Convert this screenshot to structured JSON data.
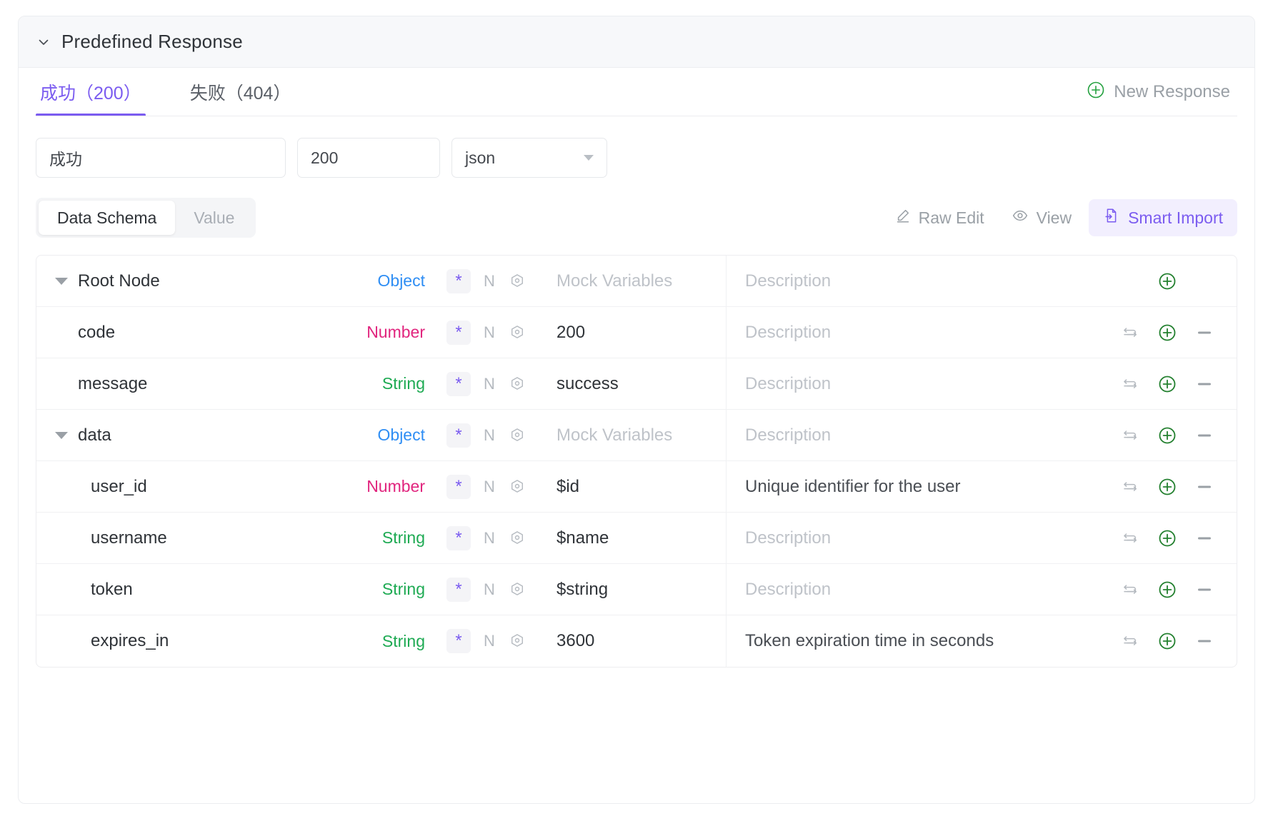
{
  "panel": {
    "title": "Predefined Response",
    "collapse_icon": "chevron-down-icon"
  },
  "tabs": [
    {
      "label": "成功（200）",
      "active": true
    },
    {
      "label": "失败（404）",
      "active": false
    }
  ],
  "new_response": {
    "label": "New Response",
    "icon": "plus-circle-icon",
    "icon_color": "#23a03e"
  },
  "fields": {
    "name_value": "成功",
    "code_value": "200",
    "type_value": "json",
    "type_caret": "chevron-down-icon"
  },
  "view_toggle": [
    {
      "label": "Data Schema",
      "active": true
    },
    {
      "label": "Value",
      "active": false
    }
  ],
  "tool_actions": [
    {
      "label": "Raw Edit",
      "icon": "pencil-icon",
      "accent": false
    },
    {
      "label": "View",
      "icon": "eye-icon",
      "accent": false
    },
    {
      "label": "Smart Import",
      "icon": "import-file-icon",
      "accent": true
    }
  ],
  "colors": {
    "accent_purple": "#7b5cf0",
    "accent_purple_bg": "#f2effe",
    "type_object": "#2f8ef4",
    "type_number": "#e1257e",
    "type_string": "#1eaa53",
    "green_add": "#23a03e",
    "header_bg": "#f7f8fa"
  },
  "schema_rows": [
    {
      "name": "Root Node",
      "indent": 0,
      "expandable": true,
      "type": "Object",
      "type_class": "t-object",
      "required_mark": "*",
      "null_mark": "N",
      "settings_icon": "hexagon-settings-icon",
      "mock": "Mock Variables",
      "mock_placeholder": true,
      "description": "Description",
      "description_placeholder": true,
      "ops": [
        "add"
      ]
    },
    {
      "name": "code",
      "indent": 1,
      "expandable": false,
      "type": "Number",
      "type_class": "t-number",
      "required_mark": "*",
      "null_mark": "N",
      "settings_icon": "hexagon-settings-icon",
      "mock": "200",
      "mock_placeholder": false,
      "description": "Description",
      "description_placeholder": true,
      "ops": [
        "swap",
        "add",
        "remove"
      ]
    },
    {
      "name": "message",
      "indent": 1,
      "expandable": false,
      "type": "String",
      "type_class": "t-string",
      "required_mark": "*",
      "null_mark": "N",
      "settings_icon": "hexagon-settings-icon",
      "mock": "success",
      "mock_placeholder": false,
      "description": "Description",
      "description_placeholder": true,
      "ops": [
        "swap",
        "add",
        "remove"
      ]
    },
    {
      "name": "data",
      "indent": 1,
      "expandable": true,
      "type": "Object",
      "type_class": "t-object",
      "required_mark": "*",
      "null_mark": "N",
      "settings_icon": "hexagon-settings-icon",
      "mock": "Mock Variables",
      "mock_placeholder": true,
      "description": "Description",
      "description_placeholder": true,
      "ops": [
        "swap",
        "add",
        "remove"
      ]
    },
    {
      "name": "user_id",
      "indent": 2,
      "expandable": false,
      "type": "Number",
      "type_class": "t-number",
      "required_mark": "*",
      "null_mark": "N",
      "settings_icon": "hexagon-settings-icon",
      "mock": "$id",
      "mock_placeholder": false,
      "description": "Unique identifier for the user",
      "description_placeholder": false,
      "ops": [
        "swap",
        "add",
        "remove"
      ]
    },
    {
      "name": "username",
      "indent": 2,
      "expandable": false,
      "type": "String",
      "type_class": "t-string",
      "required_mark": "*",
      "null_mark": "N",
      "settings_icon": "hexagon-settings-icon",
      "mock": "$name",
      "mock_placeholder": false,
      "description": "Description",
      "description_placeholder": true,
      "ops": [
        "swap",
        "add",
        "remove"
      ]
    },
    {
      "name": "token",
      "indent": 2,
      "expandable": false,
      "type": "String",
      "type_class": "t-string",
      "required_mark": "*",
      "null_mark": "N",
      "settings_icon": "hexagon-settings-icon",
      "mock": "$string",
      "mock_placeholder": false,
      "description": "Description",
      "description_placeholder": true,
      "ops": [
        "swap",
        "add",
        "remove"
      ]
    },
    {
      "name": "expires_in",
      "indent": 2,
      "expandable": false,
      "type": "String",
      "type_class": "t-string",
      "required_mark": "*",
      "null_mark": "N",
      "settings_icon": "hexagon-settings-icon",
      "mock": "3600",
      "mock_placeholder": false,
      "description": "Token expiration time in seconds",
      "description_placeholder": false,
      "ops": [
        "swap",
        "add",
        "remove"
      ]
    }
  ]
}
